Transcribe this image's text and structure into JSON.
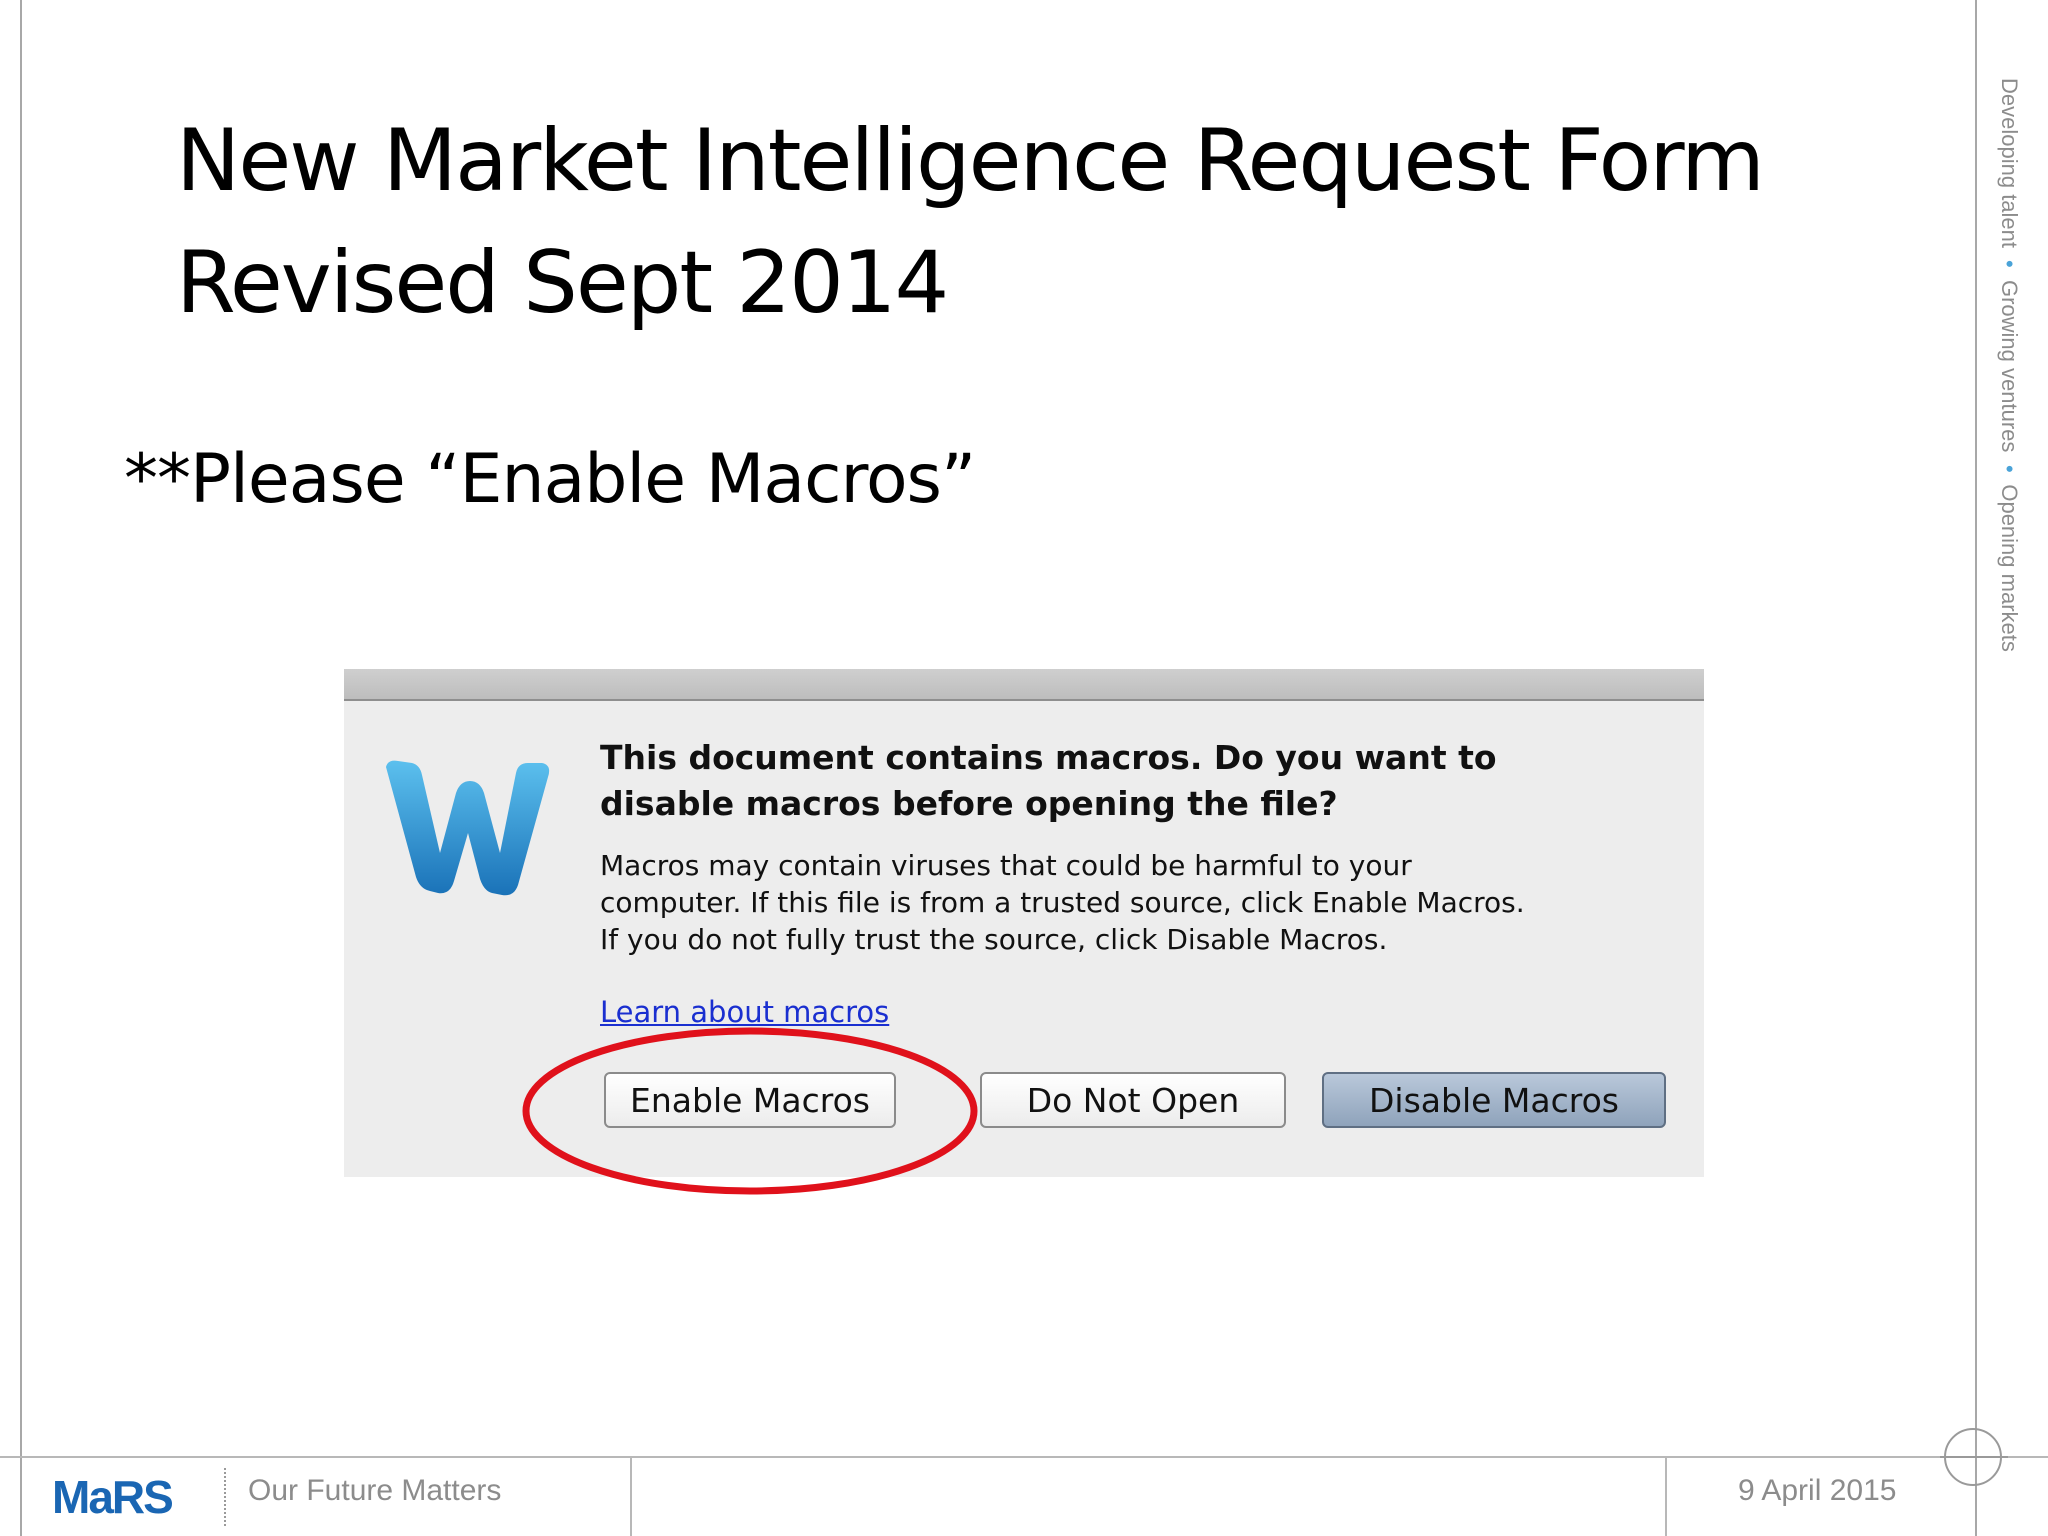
{
  "slide": {
    "title_line1": "New Market Intelligence Request Form",
    "title_line2": "Revised Sept 2014",
    "notice": "**Please “Enable Macros”",
    "side_text": {
      "part1": "Developing talent",
      "part2": "Growing ventures",
      "part3": "Opening markets",
      "separator": "•"
    }
  },
  "dialog": {
    "heading_line1": "This document contains macros. Do you want to",
    "heading_line2": "disable macros before opening the file?",
    "body_line1": "Macros may contain viruses that could be harmful to your",
    "body_line2": "computer.  If this file is from a trusted source, click Enable Macros.",
    "body_line3": "If you do not fully trust the source, click Disable Macros.",
    "learn_link": "Learn about macros",
    "buttons": {
      "enable": "Enable Macros",
      "do_not_open": "Do Not Open",
      "disable": "Disable Macros"
    },
    "icon": "word-icon",
    "highlight_color": "#e0111b"
  },
  "footer": {
    "logo": "MaRS",
    "tagline": "Our Future Matters",
    "date": "9 April 2015"
  },
  "colors": {
    "brand_blue": "#1a66b3",
    "side_dot": "#4aa3d8",
    "link": "#1a2fd0"
  }
}
